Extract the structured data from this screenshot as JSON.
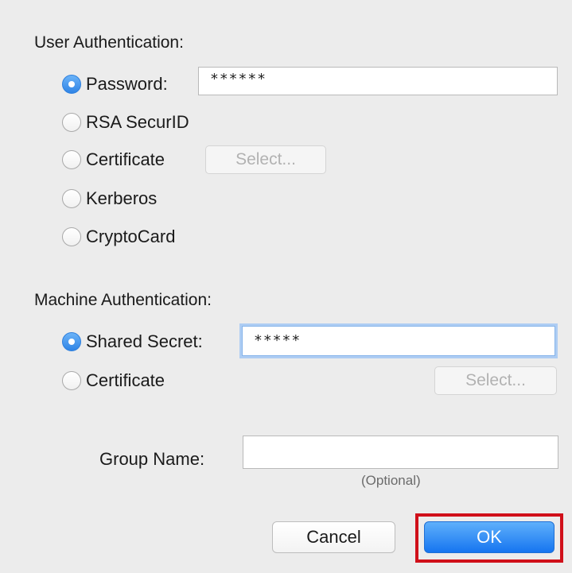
{
  "user_auth": {
    "title": "User Authentication:",
    "options": [
      {
        "label": "Password:",
        "checked": true
      },
      {
        "label": "RSA SecurID",
        "checked": false
      },
      {
        "label": "Certificate",
        "checked": false
      },
      {
        "label": "Kerberos",
        "checked": false
      },
      {
        "label": "CryptoCard",
        "checked": false
      }
    ],
    "password_value": "******",
    "certificate_select_label": "Select..."
  },
  "machine_auth": {
    "title": "Machine Authentication:",
    "options": [
      {
        "label": "Shared Secret:",
        "checked": true
      },
      {
        "label": "Certificate",
        "checked": false
      }
    ],
    "shared_secret_value": "*****",
    "certificate_select_label": "Select..."
  },
  "group": {
    "label": "Group Name:",
    "value": "",
    "hint": "(Optional)"
  },
  "buttons": {
    "cancel": "Cancel",
    "ok": "OK"
  },
  "colors": {
    "accent": "#2f84e6",
    "highlight": "#d0101a"
  }
}
